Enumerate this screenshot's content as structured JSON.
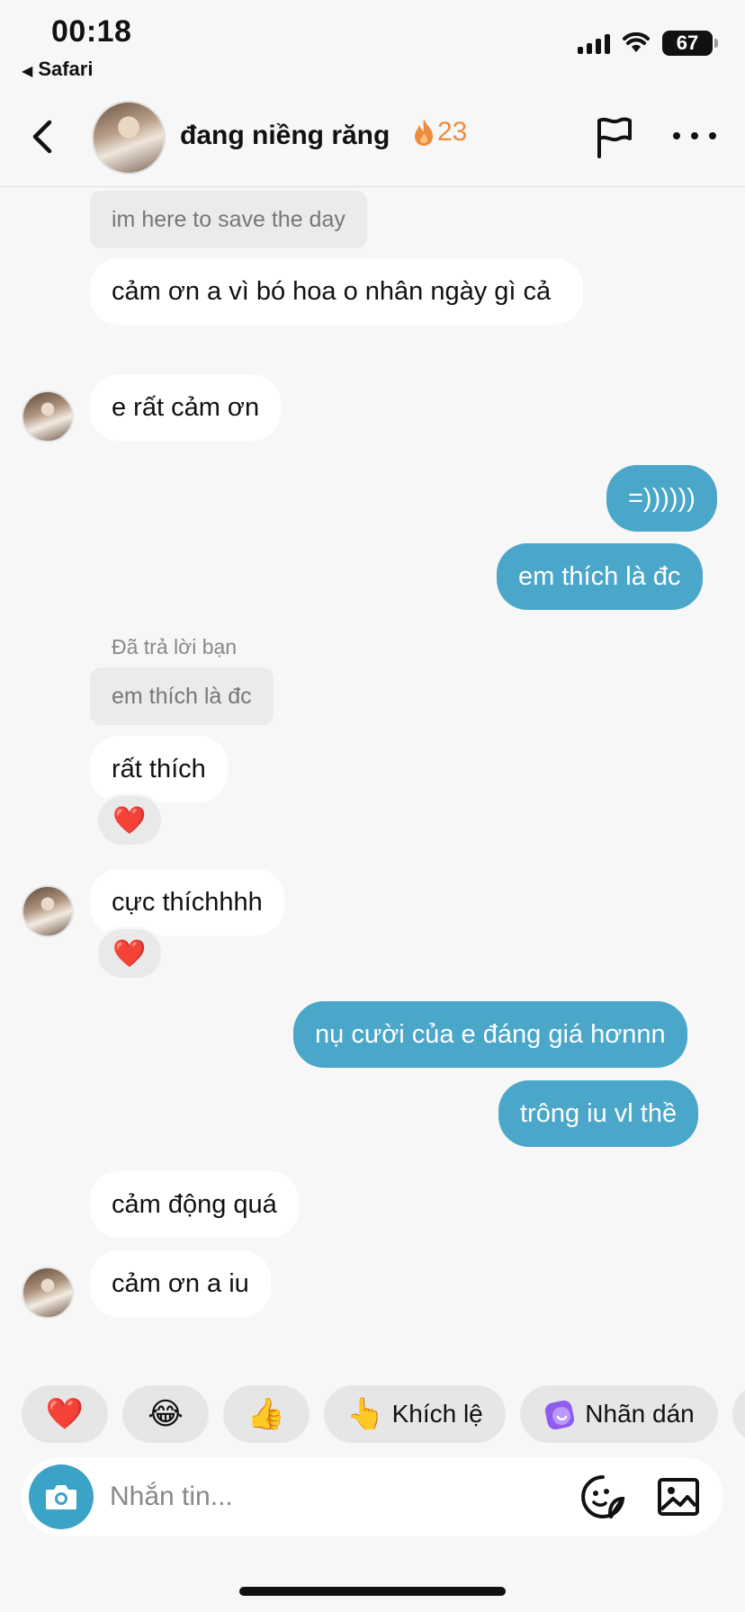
{
  "status_bar": {
    "time": "00:18",
    "back_app": "Safari",
    "battery": "67"
  },
  "header": {
    "contact_name": "đang niềng răng",
    "streak_count": "23",
    "streak_color": "#f08a3c"
  },
  "messages": {
    "quote_top": "im here to save the day",
    "in_1": "cảm ơn a vì bó hoa o nhân ngày gì cả",
    "in_2": "e rất cảm ơn",
    "out_1": "=))))))",
    "out_2": "em thích là đc",
    "reply_label": "Đã trả lời bạn",
    "quote_2": "em thích là đc",
    "in_3": "rất thích",
    "in_4": "cực thíchhhh",
    "out_3": "nụ cười của e đáng giá hơnnn",
    "out_4": "trông iu vl thề",
    "in_5": "cảm động quá",
    "in_6": "cảm ơn a iu",
    "reaction_heart": "❤️",
    "outgoing_color": "#4aa7c9"
  },
  "quick_replies": {
    "heart": "❤️",
    "laugh": "😂",
    "thumbs": "👍",
    "encourage_emoji": "👆",
    "encourage_label": "Khích lệ",
    "sticker_label": "Nhãn dán"
  },
  "composer": {
    "placeholder": "Nhắn tin..."
  }
}
